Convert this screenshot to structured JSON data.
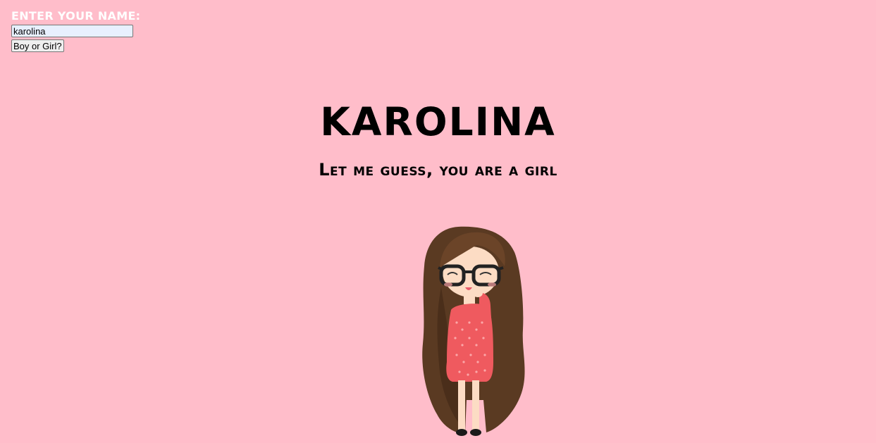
{
  "form": {
    "label": "ENTER YOUR NAME:",
    "input_value": "karolina",
    "button_label": "Boy or Girl?"
  },
  "result": {
    "name": "karolina",
    "message": "Let me guess, you are a girl"
  },
  "illustration": {
    "icon": "girl-cartoon-illustration"
  },
  "colors": {
    "background": "#ffbdca",
    "label": "#ffffff",
    "text": "#000000"
  }
}
